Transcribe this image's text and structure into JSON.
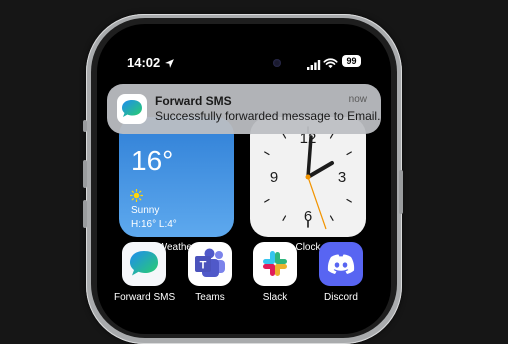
{
  "status_bar": {
    "time": "14:02",
    "battery": "99"
  },
  "notification": {
    "app": "Forward SMS",
    "message": "Successfully forwarded message to Email.",
    "time": "now"
  },
  "widgets": {
    "weather": {
      "temp": "16°",
      "condition": "Sunny",
      "high_low": "H:16° L:4°",
      "label": "Weather"
    },
    "clock": {
      "label": "Clock",
      "numerals": [
        "9",
        "3",
        "6"
      ]
    }
  },
  "apps": [
    {
      "label": "Forward SMS",
      "icon": "forward-sms-icon"
    },
    {
      "label": "Teams",
      "icon": "teams-icon"
    },
    {
      "label": "Slack",
      "icon": "slack-icon"
    },
    {
      "label": "Discord",
      "icon": "discord-icon"
    }
  ],
  "colors": {
    "background": "#161616",
    "weather_top": "#2f7fd6",
    "discord": "#5865f2",
    "notification": "#bcbec2"
  }
}
